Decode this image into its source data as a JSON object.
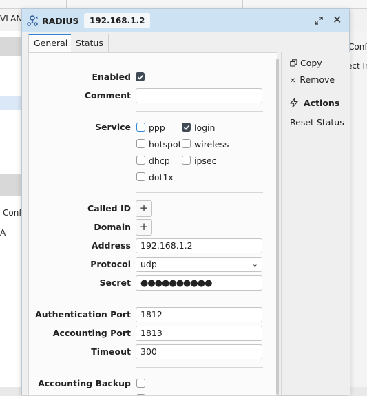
{
  "background": {
    "vlan_label": "VLAN",
    "left_conf": "Conf",
    "left_a": "A",
    "right_conf": "Conf",
    "right_ect": "ect In"
  },
  "window": {
    "app_title": "RADIUS",
    "breadcrumb_chevron": "›",
    "breadcrumb": "192.168.1.2",
    "close_glyph": "✕"
  },
  "tabs": [
    {
      "label": "General",
      "active": true
    },
    {
      "label": "Status",
      "active": false
    }
  ],
  "form": {
    "enabled": {
      "label": "Enabled",
      "checked": true
    },
    "comment": {
      "label": "Comment",
      "value": ""
    },
    "service": {
      "label": "Service",
      "options": [
        {
          "label": "ppp",
          "checked": false
        },
        {
          "label": "login",
          "checked": true
        },
        {
          "label": "hotspot",
          "checked": false
        },
        {
          "label": "wireless",
          "checked": false
        },
        {
          "label": "dhcp",
          "checked": false
        },
        {
          "label": "ipsec",
          "checked": false
        },
        {
          "label": "dot1x",
          "checked": false
        }
      ]
    },
    "called_id": {
      "label": "Called ID",
      "button": "+"
    },
    "domain": {
      "label": "Domain",
      "button": "+"
    },
    "address": {
      "label": "Address",
      "value": "192.168.1.2"
    },
    "protocol": {
      "label": "Protocol",
      "value": "udp",
      "arrow": "⌄"
    },
    "secret": {
      "label": "Secret",
      "value": "●●●●●●●●●●"
    },
    "auth_port": {
      "label": "Authentication Port",
      "value": "1812"
    },
    "acct_port": {
      "label": "Accounting Port",
      "value": "1813"
    },
    "timeout": {
      "label": "Timeout",
      "value": "300"
    },
    "acct_backup": {
      "label": "Accounting Backup",
      "checked": false
    }
  },
  "actions": {
    "copy": {
      "label": "Copy",
      "icon": "copy-icon"
    },
    "remove": {
      "label": "Remove",
      "icon": "close-icon",
      "glyph": "✕"
    },
    "header": {
      "label": "Actions",
      "icon": "lightning-icon"
    },
    "reset_status": {
      "label": "Reset Status"
    }
  },
  "colors": {
    "titlebar": "#cde2f3",
    "accent": "#2e85d6",
    "checked": "#3f4a55"
  }
}
